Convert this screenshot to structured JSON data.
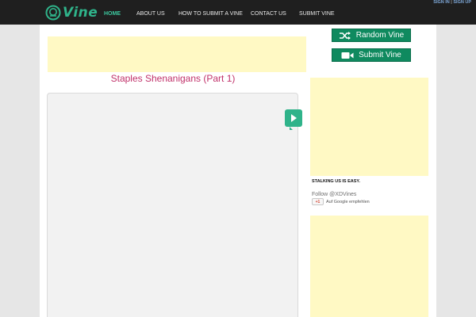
{
  "brand": {
    "logo_text": "Vine"
  },
  "nav": {
    "items": [
      {
        "label": "HOME",
        "active": true
      },
      {
        "label": "ABOUT US",
        "active": false
      },
      {
        "label": "HOW TO SUBMIT A VINE",
        "active": false
      },
      {
        "label": "CONTACT US",
        "active": false
      },
      {
        "label": "SUBMIT VINE",
        "active": false
      }
    ]
  },
  "auth": {
    "sign_in": "SIGN IN",
    "separator": "|",
    "sign_up": "SIGN UP"
  },
  "post": {
    "title": "Staples Shenanigans (Part 1)"
  },
  "sidebar": {
    "random_button": "Random Vine",
    "submit_button": "Submit Vine",
    "stalking_heading": "STALKING US IS EASY.",
    "follow_text": "Follow @XDVines",
    "gplus_button": "+1",
    "gplus_text": "Auf Google empfehlen"
  },
  "colors": {
    "topbar": "#1f1f1f",
    "accent": "#2fb38a",
    "button": "#0f8a5f",
    "title": "#c0316a",
    "ad": "#fff9c4"
  },
  "icons": [
    "vine-logo-icon",
    "shuffle-icon",
    "video-camera-icon",
    "play-icon",
    "google-plus-icon"
  ]
}
